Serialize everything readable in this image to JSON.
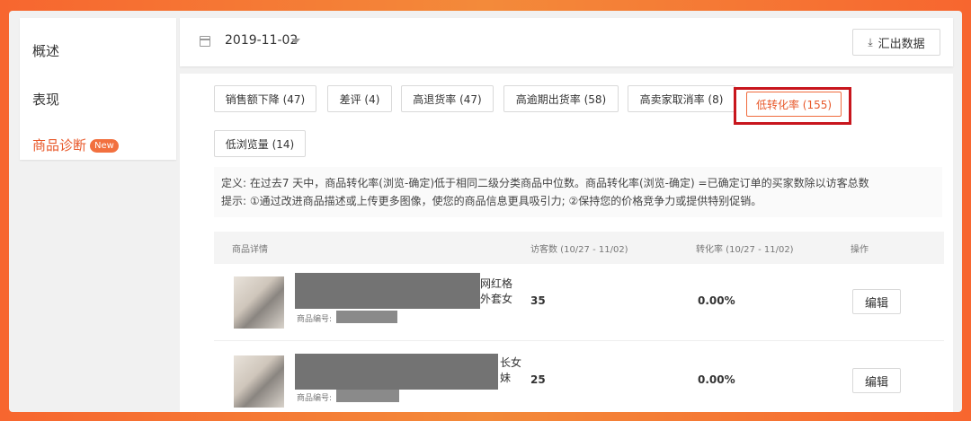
{
  "sidebar": {
    "items": [
      {
        "label": "概述"
      },
      {
        "label": "表现"
      },
      {
        "label": "商品诊断",
        "badge": "New"
      }
    ]
  },
  "toolbar": {
    "date_value": "2019-11-02",
    "export_label": "汇出数据"
  },
  "tabs": [
    {
      "label": "销售额下降 (47)"
    },
    {
      "label": "差评 (4)"
    },
    {
      "label": "高退货率 (47)"
    },
    {
      "label": "高逾期出货率 (58)"
    },
    {
      "label": "高卖家取消率 (8)"
    },
    {
      "label": "低转化率 (155)",
      "active": true
    },
    {
      "label": "低浏览量 (14)"
    }
  ],
  "definition": {
    "line1": "定义: 在过去7 天中，商品转化率(浏览-确定)低于相同二级分类商品中位数。商品转化率(浏览-确定) =已确定订单的买家数除以访客总数",
    "line2": "提示: ①通过改进商品描述或上传更多图像，使您的商品信息更具吸引力; ②保持您的价格竞争力或提供特别促销。"
  },
  "table": {
    "columns": [
      "商品详情",
      "访客数 (10/27 - 11/02)",
      "转化率 (10/27 - 11/02)",
      "操作"
    ],
    "rows": [
      {
        "title_tail_1": "网红格",
        "title_tail_2": "外套女",
        "id_label": "商品编号:",
        "visitors": "35",
        "conversion": "0.00%",
        "action": "编辑"
      },
      {
        "title_tail_1": "长女",
        "title_tail_2": "妹",
        "id_label": "商品编号:",
        "visitors": "25",
        "conversion": "0.00%",
        "action": "编辑"
      }
    ]
  },
  "colors": {
    "accent": "#e8582a",
    "highlight": "#c8161d",
    "background_orange": "#f7662f"
  }
}
